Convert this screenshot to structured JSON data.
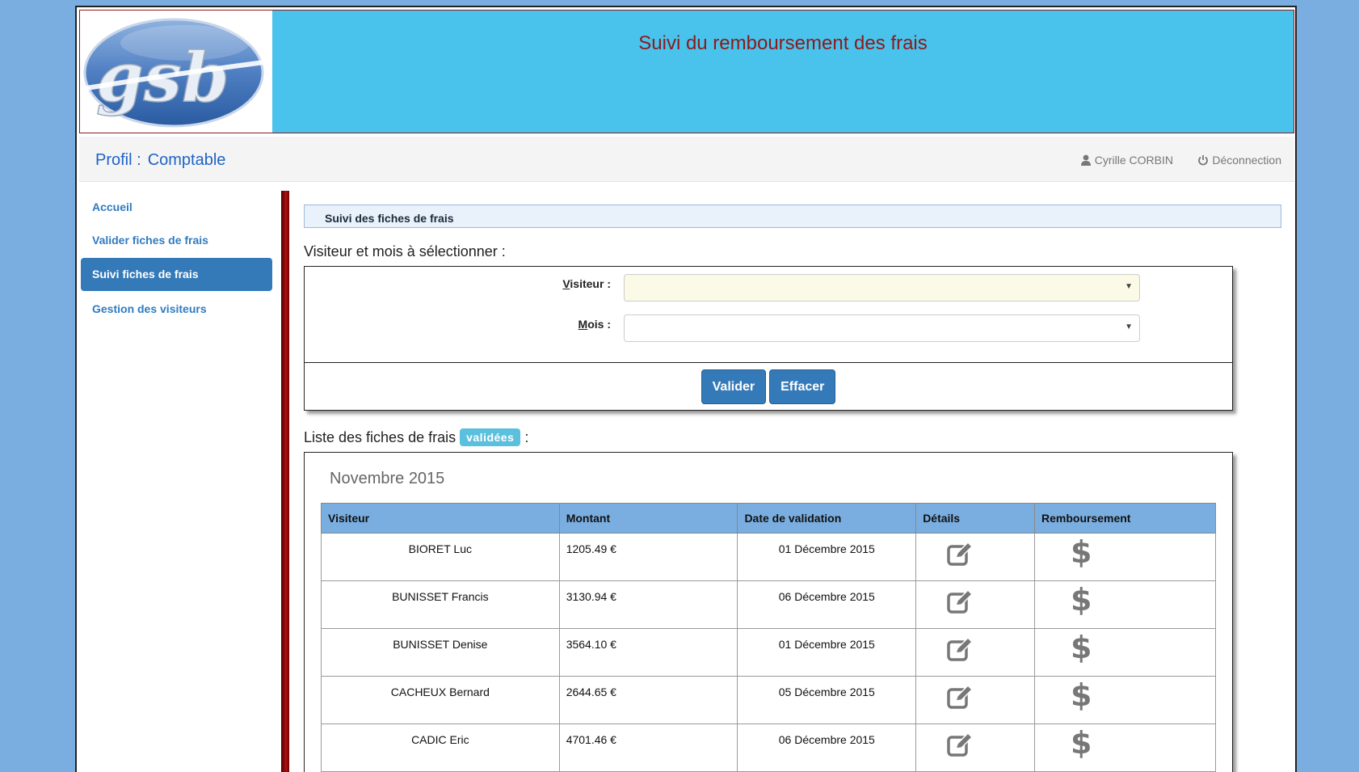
{
  "header": {
    "title": "Suivi du remboursement des frais",
    "logo_text": "gsb"
  },
  "subbar": {
    "profile_label": "Profil :",
    "profile_value": "Comptable",
    "user_name": "Cyrille CORBIN",
    "logout_label": "Déconnection"
  },
  "sidebar": {
    "items": [
      {
        "label": "Accueil"
      },
      {
        "label": "Valider fiches de frais"
      },
      {
        "label": "Suivi fiches de frais"
      },
      {
        "label": "Gestion des visiteurs"
      }
    ]
  },
  "main": {
    "panel_title": "Suivi des fiches de frais",
    "select_section_label": "Visiteur et mois à sélectionner :",
    "visiteur_label_first": "V",
    "visiteur_label_rest": "isiteur :",
    "mois_label_first": "M",
    "mois_label_rest": "ois :",
    "visiteur_value": "",
    "mois_value": "",
    "valider_button": "Valider",
    "effacer_button": "Effacer",
    "list_label_prefix": "Liste des fiches de frais",
    "list_badge": "validées",
    "list_label_suffix": ":",
    "month_title": "Novembre 2015",
    "table": {
      "headers": [
        "Visiteur",
        "Montant",
        "Date de validation",
        "Détails",
        "Remboursement"
      ],
      "rows": [
        {
          "visiteur": "BIORET Luc",
          "montant": "1205.49 €",
          "date": "01 Décembre 2015"
        },
        {
          "visiteur": "BUNISSET Francis",
          "montant": "3130.94 €",
          "date": "06 Décembre 2015"
        },
        {
          "visiteur": "BUNISSET Denise",
          "montant": "3564.10 €",
          "date": "01 Décembre 2015"
        },
        {
          "visiteur": "CACHEUX Bernard",
          "montant": "2644.65 €",
          "date": "05 Décembre 2015"
        },
        {
          "visiteur": "CADIC Eric",
          "montant": "4701.46 €",
          "date": "06 Décembre 2015"
        }
      ]
    }
  },
  "icons": {
    "user": "user-icon",
    "power": "power-icon",
    "edit": "edit-icon",
    "dollar": "dollar-icon",
    "caret": "chevron-down-icon"
  },
  "colors": {
    "background": "#7aaee0",
    "header_bg": "#4ac3ec",
    "header_title": "#8b1a1a",
    "accent": "#357ab8",
    "badge": "#5bc0de",
    "table_header": "#7aaee0"
  }
}
